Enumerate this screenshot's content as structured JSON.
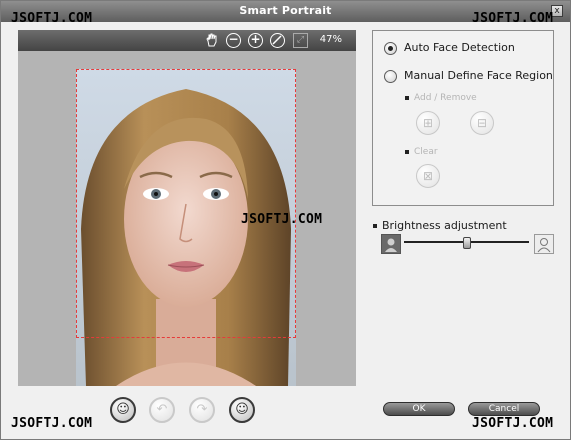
{
  "window": {
    "title": "Smart Portrait",
    "close_glyph": "x"
  },
  "watermarks": [
    "JSOFTJ.COM",
    "JSOFTJ.COM",
    "JSOFTJ.COM",
    "JSOFTJ.COM",
    "JSOFTJ.COM"
  ],
  "viewer_toolbar": {
    "icons": [
      "hand-pan-icon",
      "zoom-out-icon",
      "zoom-in-icon",
      "actual-size-icon",
      "fit-to-window-icon"
    ],
    "zoom_level": "47%"
  },
  "face_detection": {
    "auto_label": "Auto Face Detection",
    "manual_label": "Manual Define Face Region",
    "selected": "auto",
    "add_remove_label": "Add / Remove",
    "clear_label": "Clear"
  },
  "brightness": {
    "label": "Brightness adjustment",
    "level": 0.5
  },
  "bottom_toolbar": [
    "face-smile-icon",
    "undo-icon",
    "redo-icon",
    "face-preview-icon"
  ],
  "dialog": {
    "ok_label": "OK",
    "cancel_label": "Cancel"
  },
  "colors": {
    "face_rect": "#e63a3a",
    "title_bar": "#6e6e6e",
    "viewer_bg": "#b4b4b4"
  }
}
